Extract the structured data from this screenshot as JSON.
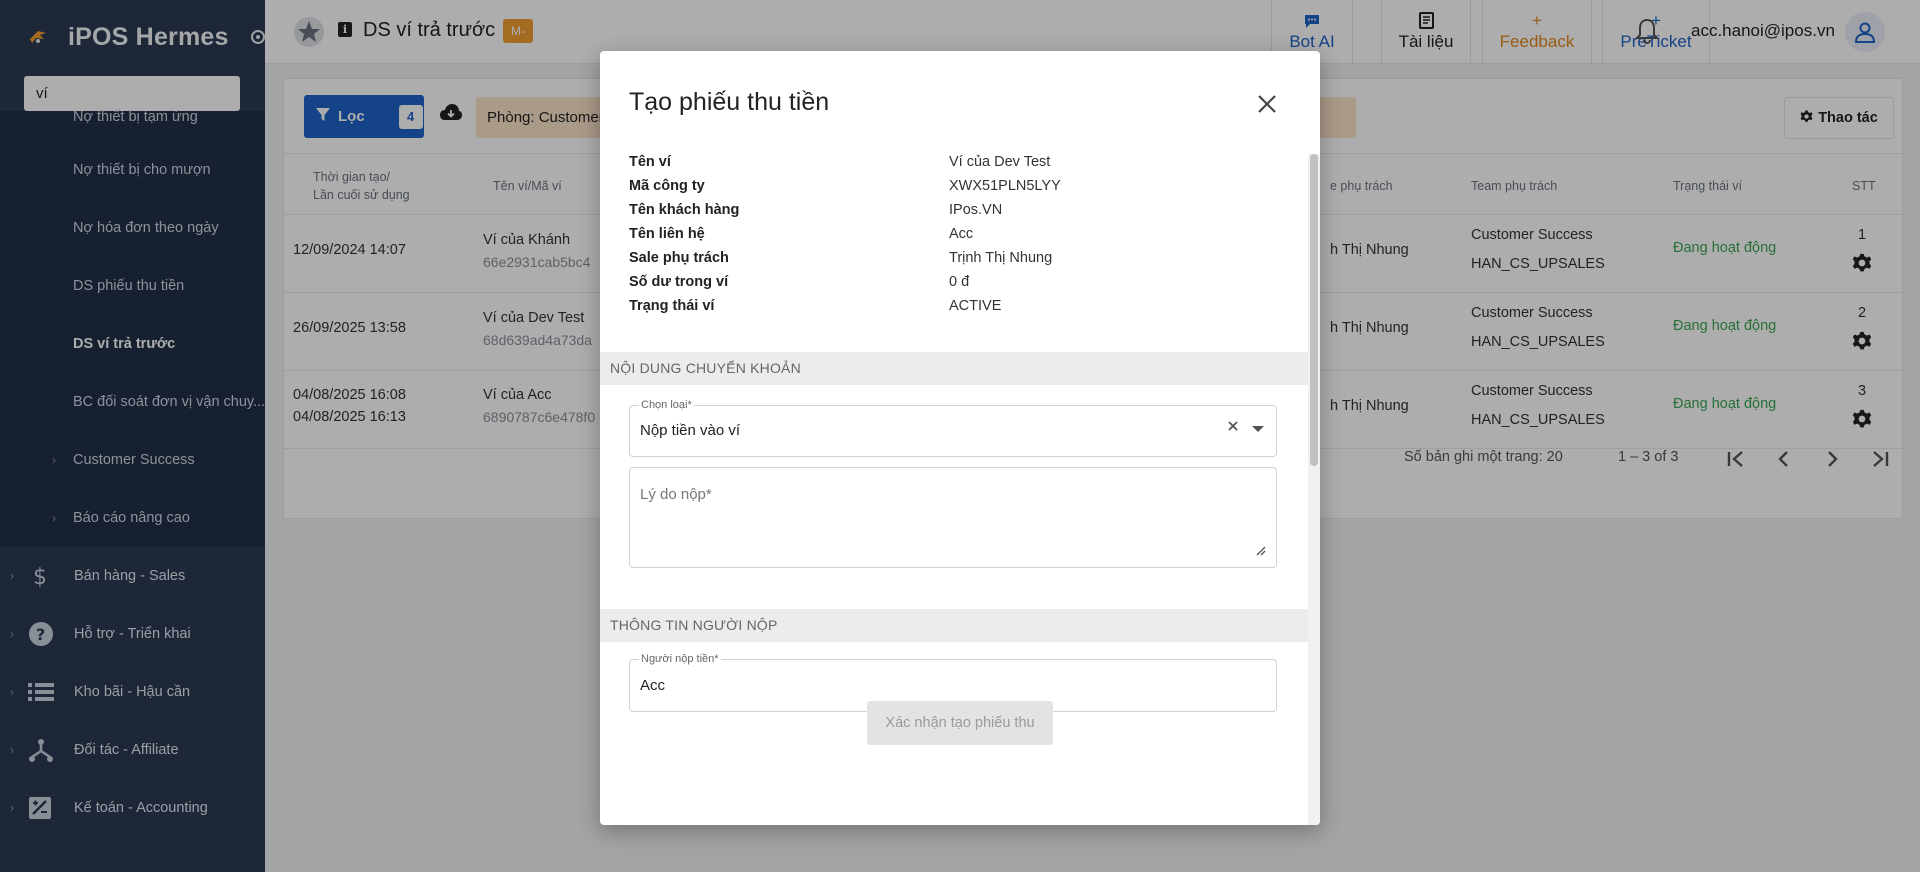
{
  "sidebar": {
    "brand": "iPOS Hermes",
    "search_value": "ví",
    "sub_items": [
      {
        "label": "Nợ thiết bị tạm ứng"
      },
      {
        "label": "Nợ thiết bị cho mượn"
      },
      {
        "label": "Nợ hóa đơn theo ngày"
      },
      {
        "label": "DS phiếu thu tiền"
      },
      {
        "label": "DS ví trả trước"
      },
      {
        "label": "BC đối soát đơn vị vận chuy..."
      }
    ],
    "sub_groups": [
      {
        "label": "Customer Success"
      },
      {
        "label": "Báo cáo nâng cao"
      }
    ],
    "main_items": [
      {
        "label": "Bán hàng - Sales",
        "icon": "dollar-icon"
      },
      {
        "label": "Hỗ trợ - Triển khai",
        "icon": "help-circle-icon"
      },
      {
        "label": "Kho bãi - Hậu cần",
        "icon": "list-icon"
      },
      {
        "label": "Đối tác - Affiliate",
        "icon": "network-icon"
      },
      {
        "label": "Kế toán - Accounting",
        "icon": "accounting-icon"
      }
    ]
  },
  "topbar": {
    "page_title": "DS ví trả trước",
    "page_tag": "M-",
    "buttons": [
      {
        "label": "Bot AI",
        "icon": "chat-icon",
        "color": "#1e63c7"
      },
      {
        "label": "Tài liệu",
        "icon": "document-icon",
        "color": "#222222"
      },
      {
        "label": "Feedback",
        "icon": "plus-icon",
        "color": "#e08a1e"
      },
      {
        "label": "PreTicket",
        "icon": "plus-icon",
        "color": "#1e63c7"
      }
    ],
    "user_email": "acc.hanoi@ipos.vn"
  },
  "toolbar": {
    "filter_label": "Lọc",
    "filter_count": "4",
    "room_chip": "Phòng: Customer",
    "action_label": "Thao tác"
  },
  "table": {
    "headers": {
      "time_line1": "Thời gian tạo/",
      "time_line2": "Lần cuối sử dụng",
      "wallet": "Tên ví/Mã ví",
      "sale": "e phụ trách",
      "team": "Team phụ trách",
      "status": "Trạng thái ví",
      "stt": "STT"
    },
    "rows": [
      {
        "time1": "12/09/2024 14:07",
        "time2": "",
        "wallet_name": "Ví của Khánh",
        "wallet_code": "66e2931cab5bc4",
        "sale": "h Thị Nhung",
        "team1": "Customer Success",
        "team2": "HAN_CS_UPSALES",
        "status": "Đang hoạt động",
        "stt": "1"
      },
      {
        "time1": "26/09/2025 13:58",
        "time2": "",
        "wallet_name": "Ví của Dev Test",
        "wallet_code": "68d639ad4a73da",
        "sale": "h Thị Nhung",
        "team1": "Customer Success",
        "team2": "HAN_CS_UPSALES",
        "status": "Đang hoạt động",
        "stt": "2"
      },
      {
        "time1": "04/08/2025 16:08",
        "time2": "04/08/2025 16:13",
        "wallet_name": "Ví của Acc",
        "wallet_code": "6890787c6e478f0",
        "sale": "h Thị Nhung",
        "team1": "Customer Success",
        "team2": "HAN_CS_UPSALES",
        "status": "Đang hoạt động",
        "stt": "3"
      }
    ],
    "status_color": "#3aa552"
  },
  "pagination": {
    "per_page_label": "Số bản ghi một trang: 20",
    "range": "1 – 3 of 3"
  },
  "modal": {
    "title": "Tạo phiếu thu tiền",
    "info": [
      {
        "key": "Tên ví",
        "value": "Ví của Dev Test"
      },
      {
        "key": "Mã công ty",
        "value": "XWX51PLN5LYY"
      },
      {
        "key": "Tên khách hàng",
        "value": "IPos.VN"
      },
      {
        "key": "Tên liên hệ",
        "value": "Acc"
      },
      {
        "key": "Sale phụ trách",
        "value": "Trịnh Thị Nhung"
      },
      {
        "key": "Số dư trong ví",
        "value": "0 đ"
      },
      {
        "key": "Trạng thái ví",
        "value": "ACTIVE"
      }
    ],
    "section_transfer": "NỘI DUNG CHUYỂN KHOẢN",
    "type_label": "Chọn loại*",
    "type_value": "Nộp tiền vào ví",
    "reason_placeholder": "Lý do nộp*",
    "section_payer": "THÔNG TIN NGƯỜI NỘP",
    "payer_label": "Người nộp tiền*",
    "payer_value": "Acc",
    "submit_label": "Xác nhận tạo phiếu thu"
  }
}
